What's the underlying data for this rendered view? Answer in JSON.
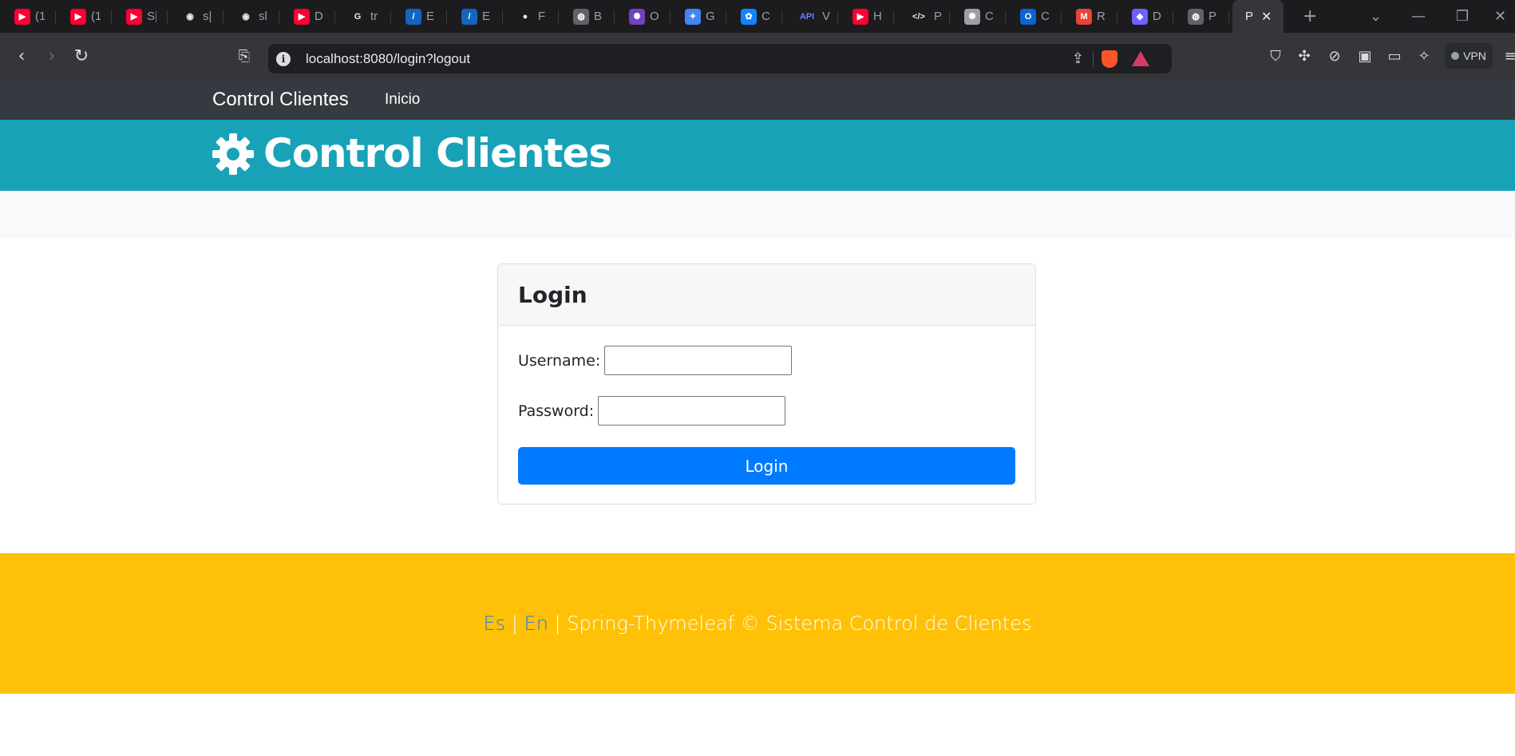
{
  "browser": {
    "tabs": [
      {
        "icon": "youtube-icon",
        "label": "(1",
        "color": "#ff0033"
      },
      {
        "icon": "youtube-icon",
        "label": "(1",
        "color": "#ff0033"
      },
      {
        "icon": "youtube-icon",
        "label": "S|",
        "color": "#ff0033"
      },
      {
        "icon": "github-icon",
        "label": "s|",
        "color": "#ffffff"
      },
      {
        "icon": "github-icon",
        "label": "sl",
        "color": "#ffffff"
      },
      {
        "icon": "youtube-icon",
        "label": "D",
        "color": "#ff0033"
      },
      {
        "icon": "google-icon",
        "label": "tr",
        "color": "#ffffff"
      },
      {
        "icon": "edteam-icon",
        "label": "E",
        "color": "#1565c0"
      },
      {
        "icon": "edteam-icon",
        "label": "E",
        "color": "#1565c0"
      },
      {
        "icon": "flickr-icon",
        "label": "F",
        "color": "#ffffff"
      },
      {
        "icon": "globe-icon",
        "label": "B",
        "color": "#5f6368"
      },
      {
        "icon": "openai-icon",
        "label": "O",
        "color": "#6f42c1"
      },
      {
        "icon": "gemini-icon",
        "label": "G",
        "color": "#4285f4"
      },
      {
        "icon": "bluesky-icon",
        "label": "C",
        "color": "#1185fe"
      },
      {
        "icon": "api-icon",
        "label": "V",
        "color": "#6c7bff"
      },
      {
        "icon": "youtube-icon",
        "label": "H",
        "color": "#ff0033"
      },
      {
        "icon": "code-icon",
        "label": "P",
        "color": "#ffffff"
      },
      {
        "icon": "openai-icon",
        "label": "C",
        "color": "#9aa0a6"
      },
      {
        "icon": "outlook-icon",
        "label": "C",
        "color": "#0a64d1"
      },
      {
        "icon": "gmail-icon",
        "label": "R",
        "color": "#ea4335"
      },
      {
        "icon": "docker-icon",
        "label": "D",
        "color": "#6c63ff"
      },
      {
        "icon": "globe-icon",
        "label": "P",
        "color": "#5f6368"
      }
    ],
    "active_tab": {
      "label": "P",
      "close": "✕"
    },
    "new_tab": "+",
    "url": "localhost:8080/login?logout",
    "vpn_label": "VPN"
  },
  "navbar": {
    "brand": "Control Clientes",
    "link_home": "Inicio"
  },
  "banner": {
    "icon": "gear-icon",
    "title": "Control Clientes"
  },
  "login": {
    "title": "Login",
    "username_label": "Username:",
    "username_value": "",
    "password_label": "Password:",
    "password_value": "",
    "submit_label": "Login"
  },
  "footer": {
    "lang_es": "Es",
    "sep1": " | ",
    "lang_en": "En",
    "text": " | Spring-Thymeleaf © Sistema Control de Clientes"
  },
  "colors": {
    "navbar": "#343a40",
    "banner": "#17a2b8",
    "primary": "#007bff",
    "footer": "#ffc107"
  }
}
